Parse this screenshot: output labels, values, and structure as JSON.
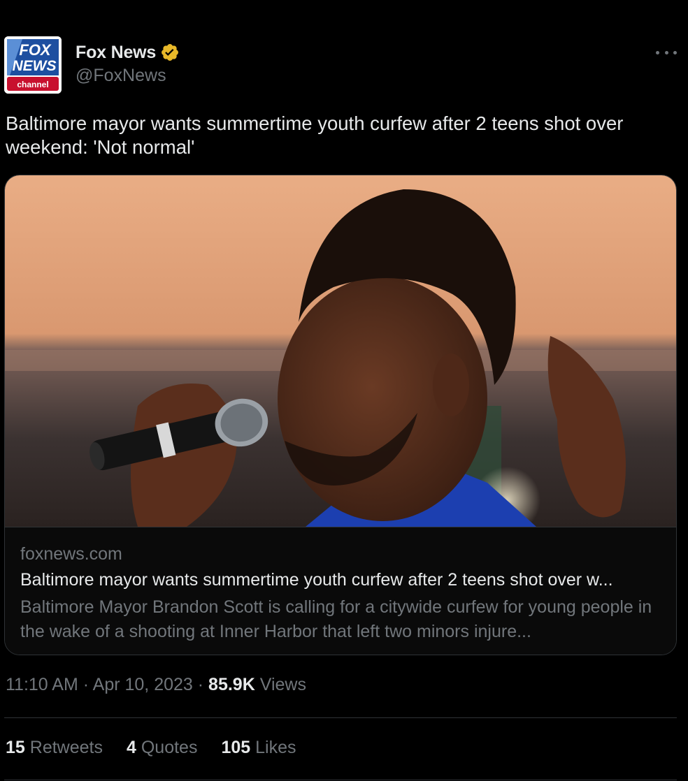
{
  "author": {
    "name": "Fox News",
    "handle": "@FoxNews",
    "logo_line1": "FOX",
    "logo_line2": "NEWS",
    "logo_line3": "channel"
  },
  "tweet": {
    "text": "Baltimore mayor wants summertime youth curfew after 2 teens shot over weekend: 'Not normal'"
  },
  "card": {
    "domain": "foxnews.com",
    "title": "Baltimore mayor wants summertime youth curfew after 2 teens shot over w...",
    "description": "Baltimore Mayor Brandon Scott is calling for a citywide curfew for young people in the wake of a shooting at Inner Harbor that left two minors injure..."
  },
  "meta": {
    "time": "11:10 AM",
    "separator": "·",
    "date": "Apr 10, 2023",
    "views_count": "85.9K",
    "views_label": "Views"
  },
  "stats": {
    "retweets_count": "15",
    "retweets_label": "Retweets",
    "quotes_count": "4",
    "quotes_label": "Quotes",
    "likes_count": "105",
    "likes_label": "Likes"
  },
  "colors": {
    "background": "#000000",
    "text_primary": "#e7e9ea",
    "text_secondary": "#71767b",
    "border": "#2f3336",
    "verified_gold": "#e8b829",
    "fox_blue": "#1d4fa0",
    "fox_red": "#c8102e"
  }
}
